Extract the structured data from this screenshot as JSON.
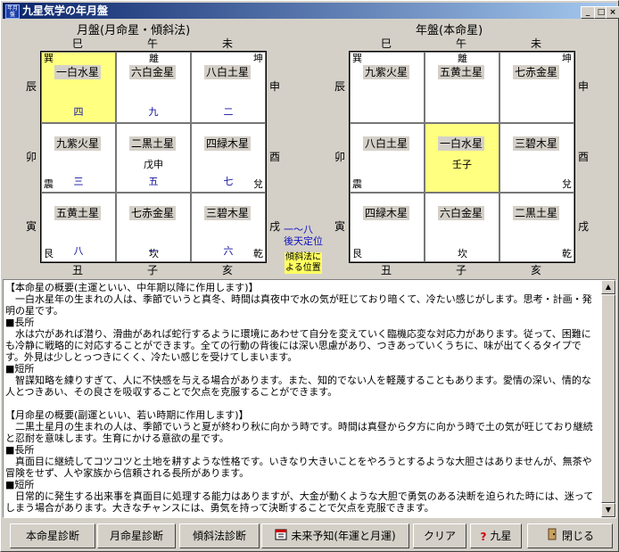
{
  "window": {
    "title": "九星気学の年月盤"
  },
  "monthly": {
    "title": "月盤(月命星・傾斜法)",
    "top_branches": [
      "巳",
      "午",
      "未"
    ],
    "bottom_branches": [
      "丑",
      "子",
      "亥"
    ],
    "left_branches": [
      "辰",
      "卯",
      "寅"
    ],
    "right_branches": [
      "申",
      "酉",
      "戌"
    ],
    "cells": [
      {
        "star": "一白水星",
        "corner_l": "巽",
        "corner_r": "",
        "num": "四",
        "mid": "",
        "corner_bl": "",
        "corner_br": ""
      },
      {
        "star": "六白金星",
        "corner_l": "",
        "corner_r": "",
        "num": "九",
        "mid": "",
        "corner_bl": "",
        "corner_br": "",
        "top_center": "離"
      },
      {
        "star": "八白土星",
        "corner_l": "",
        "corner_r": "坤",
        "num": "二",
        "mid": "",
        "corner_bl": "",
        "corner_br": ""
      },
      {
        "star": "九紫火星",
        "corner_l": "",
        "corner_r": "",
        "num": "三",
        "mid": "",
        "corner_bl": "震",
        "corner_br": ""
      },
      {
        "star": "二黒土星",
        "corner_l": "",
        "corner_r": "",
        "num": "五",
        "mid": "戊申",
        "corner_bl": "",
        "corner_br": ""
      },
      {
        "star": "四緑木星",
        "corner_l": "",
        "corner_r": "",
        "num": "七",
        "mid": "",
        "corner_bl": "",
        "corner_br": "兌"
      },
      {
        "star": "五黄土星",
        "corner_l": "",
        "corner_r": "",
        "num": "八",
        "mid": "",
        "corner_bl": "艮",
        "corner_br": ""
      },
      {
        "star": "七赤金星",
        "corner_l": "",
        "corner_r": "",
        "num": "一",
        "mid": "",
        "corner_bl": "",
        "corner_br": "",
        "bottom_center": "坎"
      },
      {
        "star": "三碧木星",
        "corner_l": "",
        "corner_r": "",
        "num": "六",
        "mid": "",
        "corner_bl": "",
        "corner_br": "乾"
      }
    ]
  },
  "yearly": {
    "title": "年盤(本命星)",
    "top_branches": [
      "巳",
      "午",
      "未"
    ],
    "bottom_branches": [
      "丑",
      "子",
      "亥"
    ],
    "left_branches": [
      "辰",
      "卯",
      "寅"
    ],
    "right_branches": [
      "申",
      "酉",
      "戌"
    ],
    "cells": [
      {
        "star": "九紫火星",
        "corner_l": "巽",
        "corner_r": "",
        "mid": "",
        "corner_bl": "",
        "corner_br": ""
      },
      {
        "star": "五黄土星",
        "corner_l": "",
        "corner_r": "",
        "mid": "",
        "corner_bl": "",
        "corner_br": "",
        "top_center": "離"
      },
      {
        "star": "七赤金星",
        "corner_l": "",
        "corner_r": "坤",
        "mid": "",
        "corner_bl": "",
        "corner_br": ""
      },
      {
        "star": "八白土星",
        "corner_l": "",
        "corner_r": "",
        "mid": "",
        "corner_bl": "震",
        "corner_br": ""
      },
      {
        "star": "一白水星",
        "corner_l": "",
        "corner_r": "",
        "mid": "壬子",
        "corner_bl": "",
        "corner_br": ""
      },
      {
        "star": "三碧木星",
        "corner_l": "",
        "corner_r": "",
        "mid": "",
        "corner_bl": "",
        "corner_br": "兌"
      },
      {
        "star": "四緑木星",
        "corner_l": "",
        "corner_r": "",
        "mid": "",
        "corner_bl": "艮",
        "corner_br": ""
      },
      {
        "star": "六白金星",
        "corner_l": "",
        "corner_r": "",
        "mid": "",
        "corner_bl": "",
        "corner_br": "",
        "bottom_center": "坎"
      },
      {
        "star": "二黒土星",
        "corner_l": "",
        "corner_r": "",
        "mid": "",
        "corner_bl": "",
        "corner_br": "乾"
      }
    ]
  },
  "notes": {
    "line1": "一～八",
    "line2": "後天定位",
    "line3": "傾斜法に",
    "line4": "よる位置"
  },
  "description": [
    "【本命星の概要(主運といい、中年期以降に作用します)】",
    "　一白水星年の生まれの人は、季節でいうと真冬、時間は真夜中で水の気が旺じており暗くて、冷たい感じがします。思考・計画・発明の星です。",
    "■長所",
    "　水は穴があれば潜り、滑曲があれば蛇行するように環境にあわせて自分を変えていく臨機応変な対応力があります。従って、困難にも冷静に戦略的に対応することができます。全ての行動の背後には深い思慮があり、つきあっていくうちに、味が出てくるタイプです。外見は少しとっつきにくく、冷たい感じを受けてしまいます。",
    "■短所",
    "　智謀知略を練りすぎて、人に不快感を与える場合があります。また、知的でない人を軽蔑することもあります。愛情の深い、情的な人とつきあい、その良さを吸収することで欠点を克服することができます。",
    "",
    "【月命星の概要(副運といい、若い時期に作用します)】",
    "　二黒土星月の生まれの人は、季節でいうと夏が終わり秋に向かう時です。時間は真昼から夕方に向かう時で土の気が旺じており継続と忍耐を意味します。生育にかける意欲の星です。",
    "■長所",
    "　真面目に継続してコツコツと土地を耕すような性格です。いきなり大きいことをやろうとするような大胆さはありませんが、無茶や冒険をせず、人や家族から信頼される長所があります。",
    "■短所",
    "　日常的に発生する出来事を真面目に処理する能力はありますが、大金が動くような大胆で勇気のある決断を迫られた時には、迷ってしまう場合があります。大きなチャンスには、勇気を持って決断することで欠点を克服できます。"
  ],
  "buttons": {
    "honmei": "本命星診断",
    "getsumei": "月命星診断",
    "keisha": "傾斜法診断",
    "mirai": "未来予知(年運と月運)",
    "clear": "クリア",
    "kyusei": "九星",
    "close": "閉じる"
  },
  "colors": {
    "highlight": "#ffff80",
    "title_start": "#0a246a",
    "title_end": "#a6caf0",
    "number_blue": "#1010a0"
  }
}
